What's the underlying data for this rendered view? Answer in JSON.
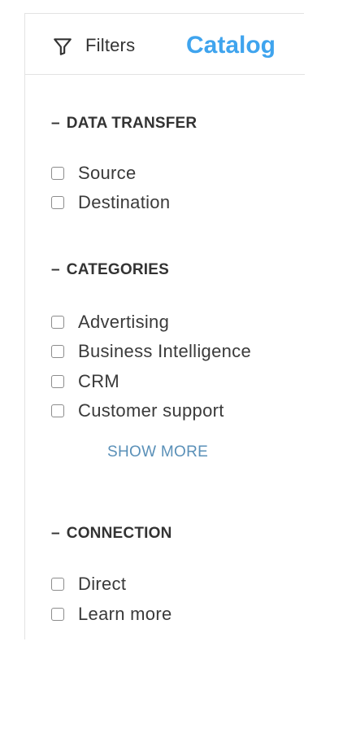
{
  "header": {
    "icon": "filter-icon",
    "filters_label": "Filters",
    "title": "Catalog",
    "title_color": "#3fa4ee"
  },
  "sections": {
    "data_transfer": {
      "collapse_symbol": "–",
      "title": "DATA TRANSFER",
      "options": [
        {
          "label": "Source",
          "checked": false
        },
        {
          "label": "Destination",
          "checked": false
        }
      ]
    },
    "categories": {
      "collapse_symbol": "–",
      "title": "CATEGORIES",
      "options": [
        {
          "label": "Advertising",
          "checked": false
        },
        {
          "label": "Business Intelligence",
          "checked": false
        },
        {
          "label": "CRM",
          "checked": false
        },
        {
          "label": "Customer support",
          "checked": false
        }
      ],
      "show_more_label": "SHOW MORE"
    },
    "connection": {
      "collapse_symbol": "–",
      "title": "CONNECTION",
      "options": [
        {
          "label": "Direct",
          "checked": false
        },
        {
          "label": "Learn more",
          "checked": false
        }
      ]
    }
  }
}
